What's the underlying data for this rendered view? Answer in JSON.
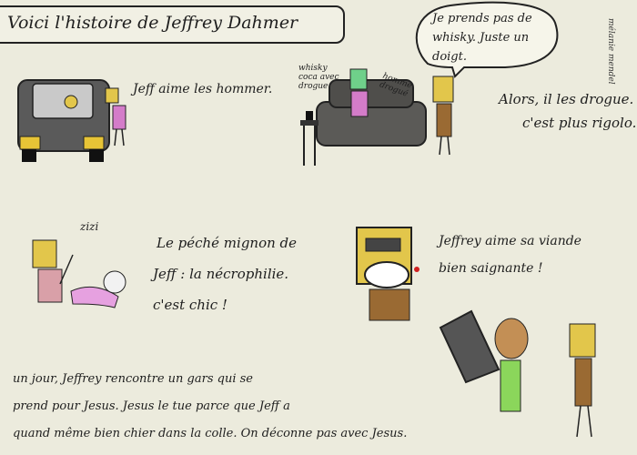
{
  "title": "Voici l'histoire de Jeffrey Dahmer",
  "panel1": {
    "caption": "Jeff aime les hommer."
  },
  "panel2": {
    "label_drink": [
      "whisky",
      "coca avec",
      "drogue"
    ],
    "label_man": [
      "homme",
      "drogué"
    ],
    "speech": "Je prends pas de whisky. Juste un doigt.",
    "caption": [
      "Alors, il les drogue.",
      "c'est plus rigolo."
    ]
  },
  "panel3": {
    "label": "zizi",
    "caption": [
      "Le péché mignon de",
      "Jeff : la nécrophilie.",
      "c'est chic !"
    ]
  },
  "panel4": {
    "caption": [
      "Jeffrey aime sa viande",
      "bien saignante !"
    ]
  },
  "panel5": {
    "caption": [
      "un jour, Jeffrey rencontre un gars qui se",
      "prend pour Jesus. Jesus le tue parce que Jeff a",
      "quand même bien chier dans la colle. On déconne pas avec Jesus."
    ]
  },
  "signature": "mélanie mendel"
}
